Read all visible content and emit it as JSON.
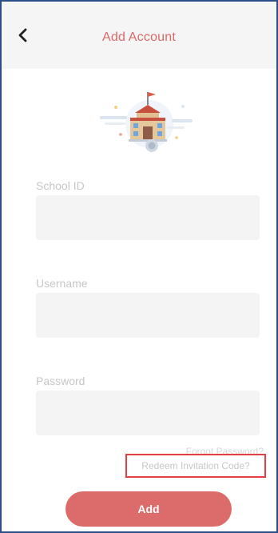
{
  "header": {
    "title": "Add Account",
    "back_icon": "chevron-left-icon",
    "accent_color": "#d96a6a"
  },
  "illustration": {
    "icon": "school-building-icon"
  },
  "form": {
    "school_id": {
      "label": "School ID",
      "value": "",
      "placeholder": ""
    },
    "username": {
      "label": "Username",
      "value": "",
      "placeholder": ""
    },
    "password": {
      "label": "Password",
      "value": "",
      "placeholder": ""
    }
  },
  "links": {
    "forgot_password": "Forgot Password?",
    "redeem_invitation_code": "Redeem Invitation Code?"
  },
  "actions": {
    "add_label": "Add",
    "button_color": "#dc6c6c"
  },
  "highlight": {
    "color": "#e53d46"
  }
}
